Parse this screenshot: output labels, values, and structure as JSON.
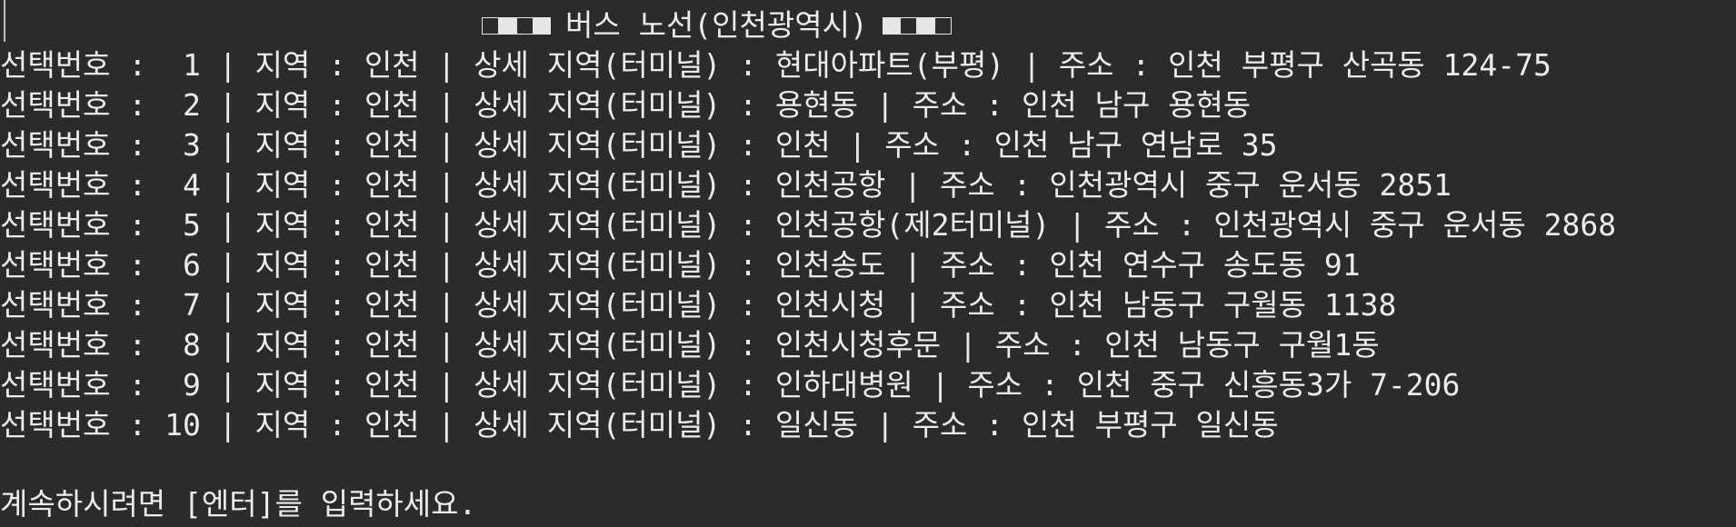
{
  "title": {
    "label": "버스 노선(인천광역시)",
    "left_deco": [
      "outline",
      "filled",
      "outline",
      "filled"
    ],
    "right_deco": [
      "filled",
      "outline",
      "filled",
      "outline"
    ]
  },
  "labels": {
    "select": "선택번호",
    "region": "지역",
    "detail": "상세 지역(터미널)",
    "address": "주소",
    "sep": "|",
    "colon": ":"
  },
  "routes": [
    {
      "no": "1",
      "region": "인천",
      "terminal": "현대아파트(부평)",
      "address": "인천 부평구 산곡동 124-75"
    },
    {
      "no": "2",
      "region": "인천",
      "terminal": "용현동",
      "address": "인천 남구 용현동"
    },
    {
      "no": "3",
      "region": "인천",
      "terminal": "인천",
      "address": "인천 남구 연남로 35"
    },
    {
      "no": "4",
      "region": "인천",
      "terminal": "인천공항",
      "address": "인천광역시 중구 운서동 2851"
    },
    {
      "no": "5",
      "region": "인천",
      "terminal": "인천공항(제2터미널)",
      "address": "인천광역시 중구 운서동 2868"
    },
    {
      "no": "6",
      "region": "인천",
      "terminal": "인천송도",
      "address": "인천 연수구 송도동 91"
    },
    {
      "no": "7",
      "region": "인천",
      "terminal": "인천시청",
      "address": "인천 남동구 구월동 1138"
    },
    {
      "no": "8",
      "region": "인천",
      "terminal": "인천시청후문",
      "address": "인천 남동구 구월1동"
    },
    {
      "no": "9",
      "region": "인천",
      "terminal": "인하대병원",
      "address": "인천 중구 신흥동3가 7-206"
    },
    {
      "no": "10",
      "region": "인천",
      "terminal": "일신동",
      "address": "인천 부평구 일신동"
    }
  ],
  "prompt": "계속하시려면 [엔터]를 입력하세요.",
  "colors": {
    "background": "#2b2b2b",
    "text": "#ececec"
  }
}
